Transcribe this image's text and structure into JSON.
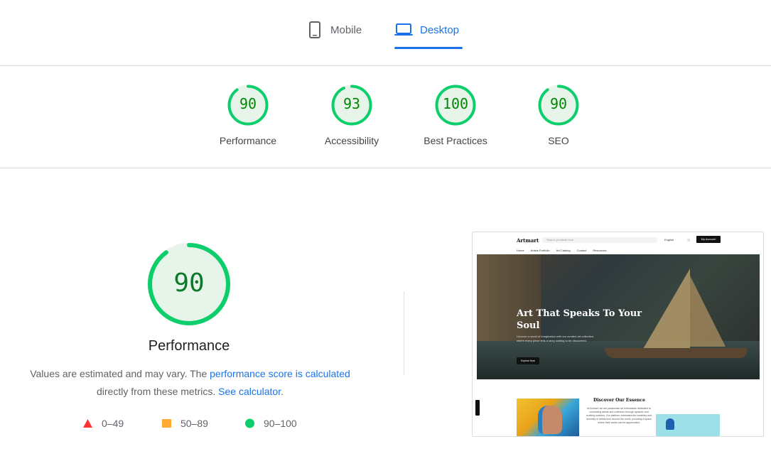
{
  "tabs": {
    "mobile_label": "Mobile",
    "desktop_label": "Desktop",
    "active": "Desktop",
    "accent_color": "#1a73e8"
  },
  "gauges": [
    {
      "score": "90",
      "label": "Performance",
      "fraction": 0.9
    },
    {
      "score": "93",
      "label": "Accessibility",
      "fraction": 0.93
    },
    {
      "score": "100",
      "label": "Best Practices",
      "fraction": 1.0
    },
    {
      "score": "90",
      "label": "SEO",
      "fraction": 0.9
    }
  ],
  "performance": {
    "score": "90",
    "fraction": 0.9,
    "title": "Performance",
    "desc_prefix": "Values are estimated and may vary. The",
    "desc_link1": "performance score is calculated",
    "desc_middle": "directly from these metrics.",
    "desc_link2": "See calculator",
    "desc_suffix": "."
  },
  "legend": [
    {
      "range": "0–49",
      "shape": "triangle",
      "color": "#ff3333"
    },
    {
      "range": "50–89",
      "shape": "square",
      "color": "#ffaa33"
    },
    {
      "range": "90–100",
      "shape": "circle",
      "color": "#0cce6b"
    }
  ],
  "colors": {
    "pass_green": "#0cce6b",
    "pass_text": "#008800",
    "pass_fill": "#e6f4ea"
  },
  "preview": {
    "logo": "Artmart",
    "search_placeholder": "Search products here",
    "language": "English",
    "account_button": "My Account",
    "menu": [
      "Home",
      "Artists Portfolio",
      "Art Catalog",
      "Contact",
      "Resources"
    ],
    "hero_title": "Art That Speaks To Your Soul",
    "hero_text": "Uncover a world of imagination with our curated art collection, where every piece tells a story waiting to be discovered.",
    "hero_button": "Explore Now",
    "section_title": "Discover Our Essence",
    "section_text": "At Artmart, we are passionate art enthusiasts dedicated to connecting artists and collectors through dynamic and exciting auctions. Our platform celebrates the creativity and diversity of artists from around the world, providing a space where their works can be appreciated."
  }
}
